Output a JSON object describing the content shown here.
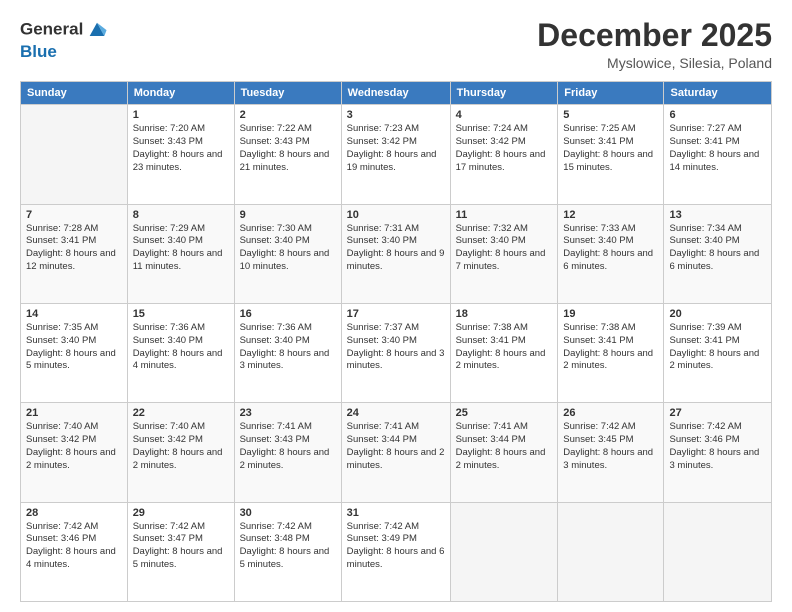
{
  "header": {
    "logo_line1": "General",
    "logo_line2": "Blue",
    "month": "December 2025",
    "location": "Myslowice, Silesia, Poland"
  },
  "weekdays": [
    "Sunday",
    "Monday",
    "Tuesday",
    "Wednesday",
    "Thursday",
    "Friday",
    "Saturday"
  ],
  "weeks": [
    [
      {
        "day": "",
        "empty": true
      },
      {
        "day": "1",
        "sunrise": "Sunrise: 7:20 AM",
        "sunset": "Sunset: 3:43 PM",
        "daylight": "Daylight: 8 hours and 23 minutes."
      },
      {
        "day": "2",
        "sunrise": "Sunrise: 7:22 AM",
        "sunset": "Sunset: 3:43 PM",
        "daylight": "Daylight: 8 hours and 21 minutes."
      },
      {
        "day": "3",
        "sunrise": "Sunrise: 7:23 AM",
        "sunset": "Sunset: 3:42 PM",
        "daylight": "Daylight: 8 hours and 19 minutes."
      },
      {
        "day": "4",
        "sunrise": "Sunrise: 7:24 AM",
        "sunset": "Sunset: 3:42 PM",
        "daylight": "Daylight: 8 hours and 17 minutes."
      },
      {
        "day": "5",
        "sunrise": "Sunrise: 7:25 AM",
        "sunset": "Sunset: 3:41 PM",
        "daylight": "Daylight: 8 hours and 15 minutes."
      },
      {
        "day": "6",
        "sunrise": "Sunrise: 7:27 AM",
        "sunset": "Sunset: 3:41 PM",
        "daylight": "Daylight: 8 hours and 14 minutes."
      }
    ],
    [
      {
        "day": "7",
        "sunrise": "Sunrise: 7:28 AM",
        "sunset": "Sunset: 3:41 PM",
        "daylight": "Daylight: 8 hours and 12 minutes."
      },
      {
        "day": "8",
        "sunrise": "Sunrise: 7:29 AM",
        "sunset": "Sunset: 3:40 PM",
        "daylight": "Daylight: 8 hours and 11 minutes."
      },
      {
        "day": "9",
        "sunrise": "Sunrise: 7:30 AM",
        "sunset": "Sunset: 3:40 PM",
        "daylight": "Daylight: 8 hours and 10 minutes."
      },
      {
        "day": "10",
        "sunrise": "Sunrise: 7:31 AM",
        "sunset": "Sunset: 3:40 PM",
        "daylight": "Daylight: 8 hours and 9 minutes."
      },
      {
        "day": "11",
        "sunrise": "Sunrise: 7:32 AM",
        "sunset": "Sunset: 3:40 PM",
        "daylight": "Daylight: 8 hours and 7 minutes."
      },
      {
        "day": "12",
        "sunrise": "Sunrise: 7:33 AM",
        "sunset": "Sunset: 3:40 PM",
        "daylight": "Daylight: 8 hours and 6 minutes."
      },
      {
        "day": "13",
        "sunrise": "Sunrise: 7:34 AM",
        "sunset": "Sunset: 3:40 PM",
        "daylight": "Daylight: 8 hours and 6 minutes."
      }
    ],
    [
      {
        "day": "14",
        "sunrise": "Sunrise: 7:35 AM",
        "sunset": "Sunset: 3:40 PM",
        "daylight": "Daylight: 8 hours and 5 minutes."
      },
      {
        "day": "15",
        "sunrise": "Sunrise: 7:36 AM",
        "sunset": "Sunset: 3:40 PM",
        "daylight": "Daylight: 8 hours and 4 minutes."
      },
      {
        "day": "16",
        "sunrise": "Sunrise: 7:36 AM",
        "sunset": "Sunset: 3:40 PM",
        "daylight": "Daylight: 8 hours and 3 minutes."
      },
      {
        "day": "17",
        "sunrise": "Sunrise: 7:37 AM",
        "sunset": "Sunset: 3:40 PM",
        "daylight": "Daylight: 8 hours and 3 minutes."
      },
      {
        "day": "18",
        "sunrise": "Sunrise: 7:38 AM",
        "sunset": "Sunset: 3:41 PM",
        "daylight": "Daylight: 8 hours and 2 minutes."
      },
      {
        "day": "19",
        "sunrise": "Sunrise: 7:38 AM",
        "sunset": "Sunset: 3:41 PM",
        "daylight": "Daylight: 8 hours and 2 minutes."
      },
      {
        "day": "20",
        "sunrise": "Sunrise: 7:39 AM",
        "sunset": "Sunset: 3:41 PM",
        "daylight": "Daylight: 8 hours and 2 minutes."
      }
    ],
    [
      {
        "day": "21",
        "sunrise": "Sunrise: 7:40 AM",
        "sunset": "Sunset: 3:42 PM",
        "daylight": "Daylight: 8 hours and 2 minutes."
      },
      {
        "day": "22",
        "sunrise": "Sunrise: 7:40 AM",
        "sunset": "Sunset: 3:42 PM",
        "daylight": "Daylight: 8 hours and 2 minutes."
      },
      {
        "day": "23",
        "sunrise": "Sunrise: 7:41 AM",
        "sunset": "Sunset: 3:43 PM",
        "daylight": "Daylight: 8 hours and 2 minutes."
      },
      {
        "day": "24",
        "sunrise": "Sunrise: 7:41 AM",
        "sunset": "Sunset: 3:44 PM",
        "daylight": "Daylight: 8 hours and 2 minutes."
      },
      {
        "day": "25",
        "sunrise": "Sunrise: 7:41 AM",
        "sunset": "Sunset: 3:44 PM",
        "daylight": "Daylight: 8 hours and 2 minutes."
      },
      {
        "day": "26",
        "sunrise": "Sunrise: 7:42 AM",
        "sunset": "Sunset: 3:45 PM",
        "daylight": "Daylight: 8 hours and 3 minutes."
      },
      {
        "day": "27",
        "sunrise": "Sunrise: 7:42 AM",
        "sunset": "Sunset: 3:46 PM",
        "daylight": "Daylight: 8 hours and 3 minutes."
      }
    ],
    [
      {
        "day": "28",
        "sunrise": "Sunrise: 7:42 AM",
        "sunset": "Sunset: 3:46 PM",
        "daylight": "Daylight: 8 hours and 4 minutes."
      },
      {
        "day": "29",
        "sunrise": "Sunrise: 7:42 AM",
        "sunset": "Sunset: 3:47 PM",
        "daylight": "Daylight: 8 hours and 5 minutes."
      },
      {
        "day": "30",
        "sunrise": "Sunrise: 7:42 AM",
        "sunset": "Sunset: 3:48 PM",
        "daylight": "Daylight: 8 hours and 5 minutes."
      },
      {
        "day": "31",
        "sunrise": "Sunrise: 7:42 AM",
        "sunset": "Sunset: 3:49 PM",
        "daylight": "Daylight: 8 hours and 6 minutes."
      },
      {
        "day": "",
        "empty": true
      },
      {
        "day": "",
        "empty": true
      },
      {
        "day": "",
        "empty": true
      }
    ]
  ]
}
